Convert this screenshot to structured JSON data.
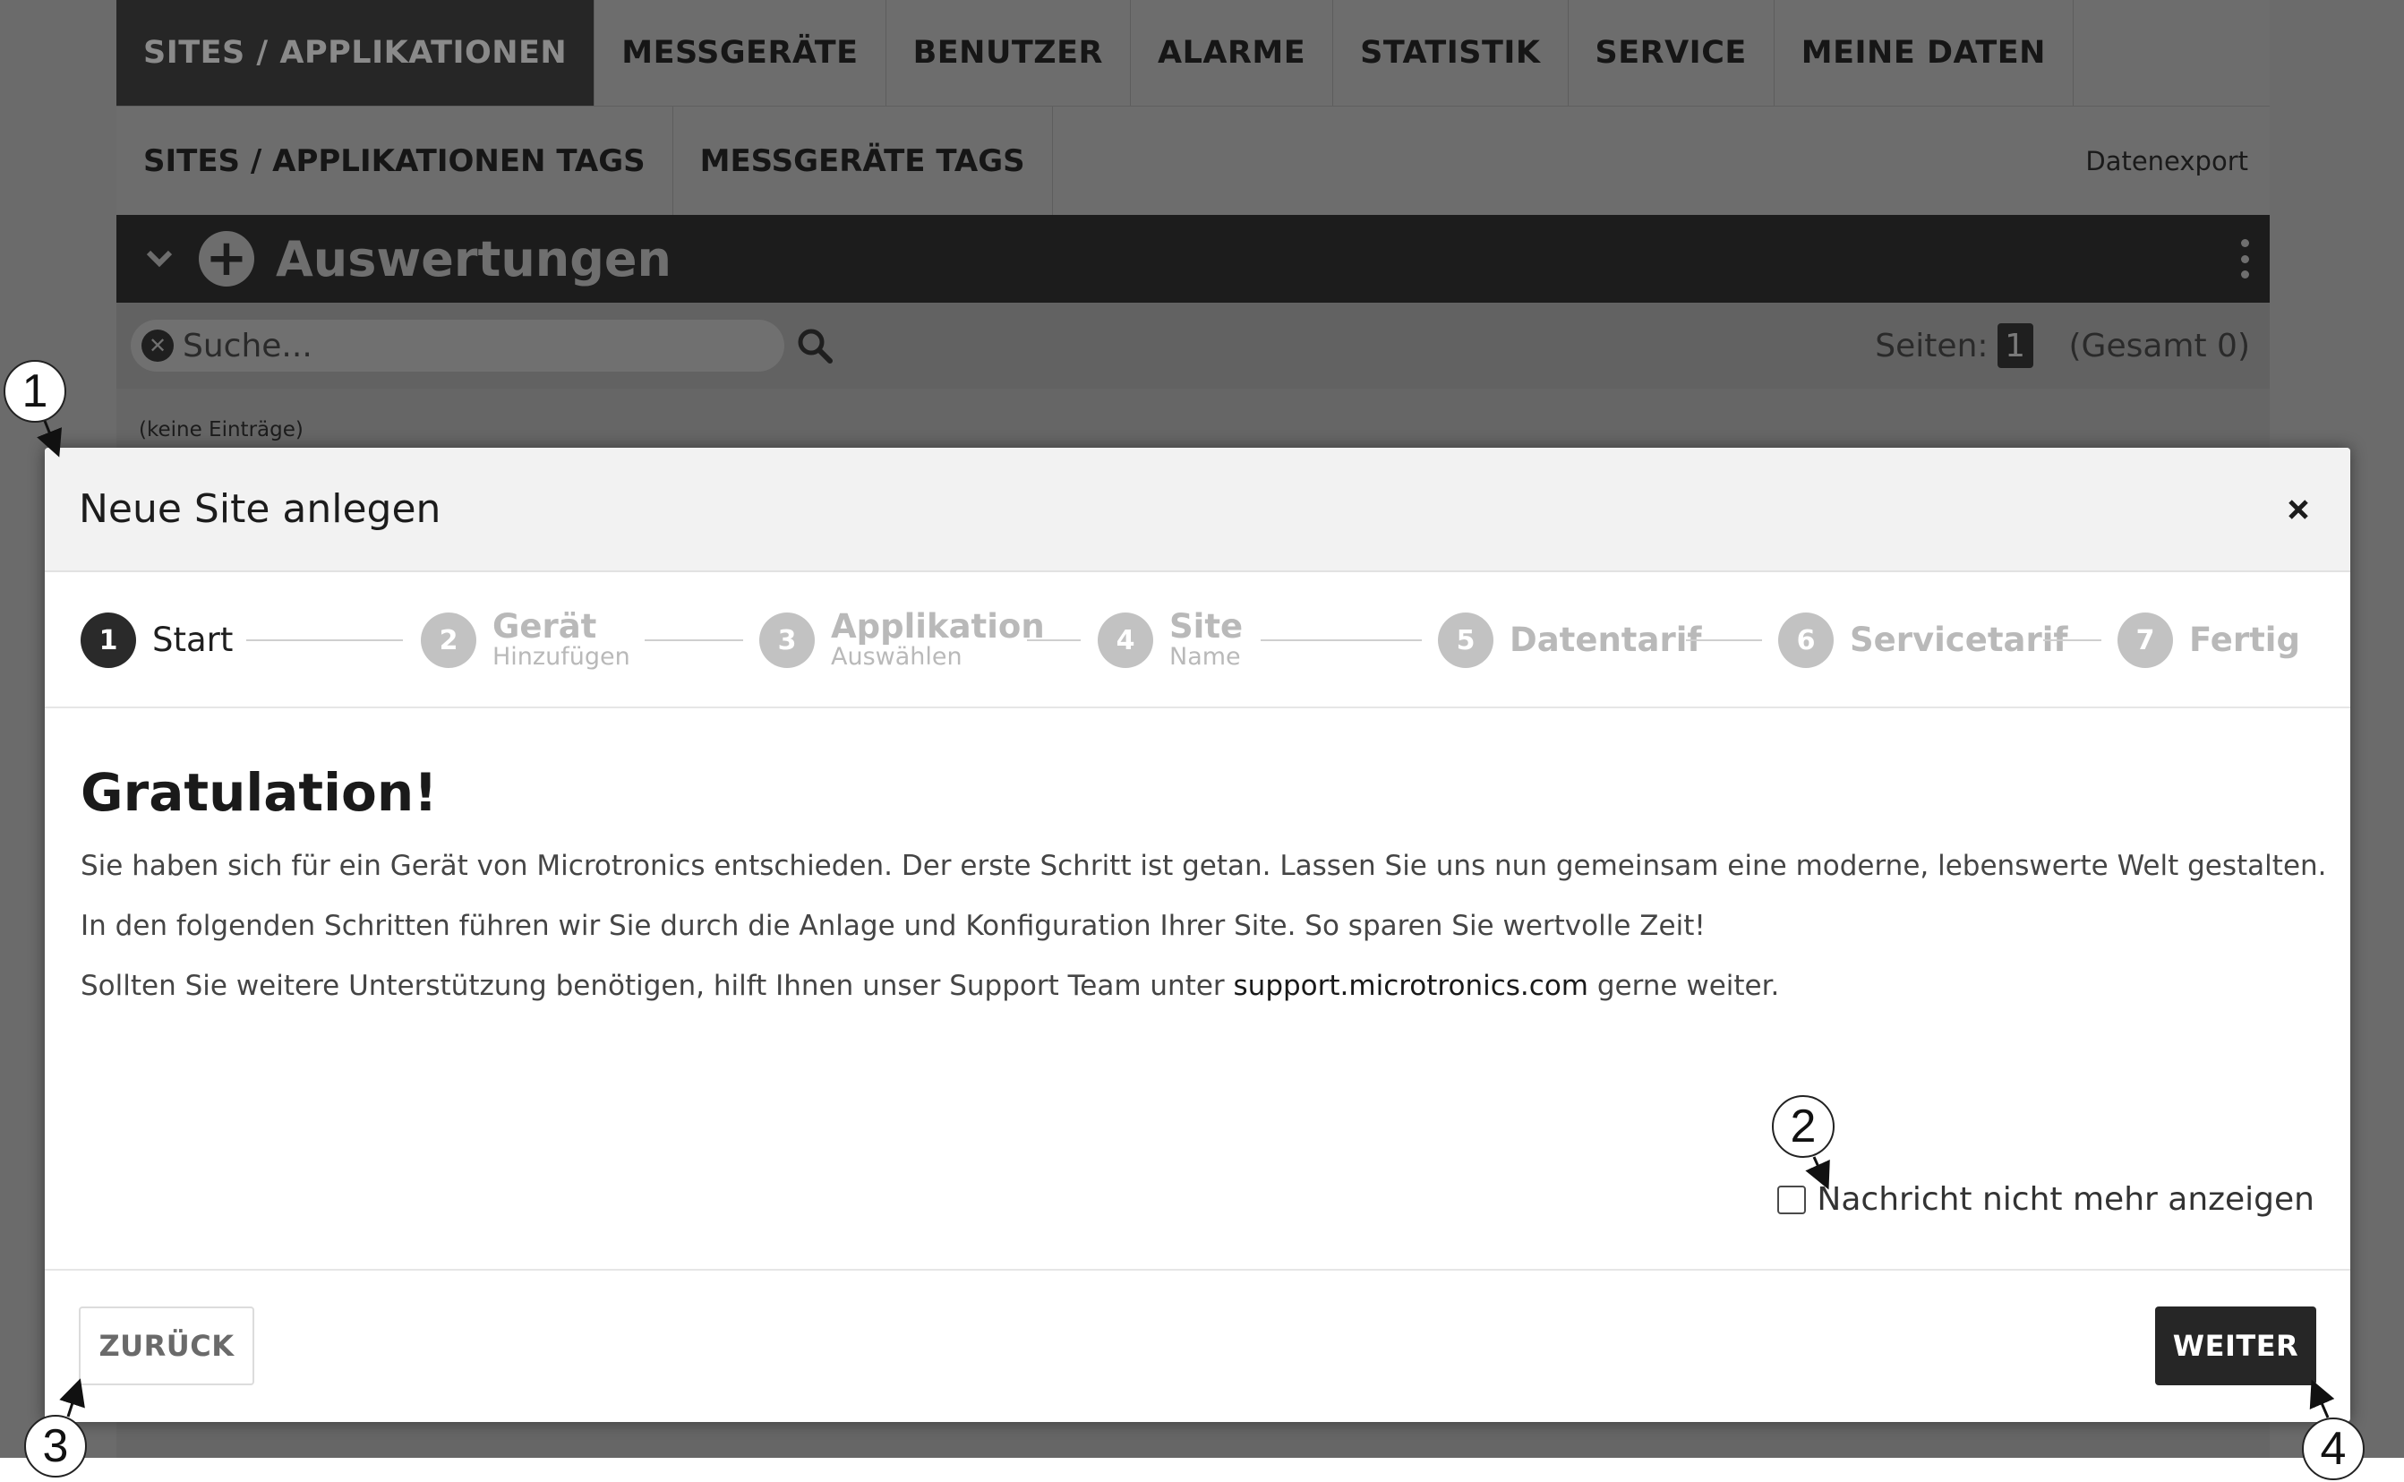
{
  "top_nav": [
    {
      "label": "SITES / APPLIKATIONEN",
      "active": true
    },
    {
      "label": "MESSGERÄTE",
      "active": false
    },
    {
      "label": "BENUTZER",
      "active": false
    },
    {
      "label": "ALARME",
      "active": false
    },
    {
      "label": "STATISTIK",
      "active": false
    },
    {
      "label": "SERVICE",
      "active": false
    },
    {
      "label": "MEINE DATEN",
      "active": false
    }
  ],
  "sub_nav": {
    "items": [
      "SITES / APPLIKATIONEN TAGS",
      "MESSGERÄTE TAGS"
    ],
    "export_label": "Datenexport"
  },
  "section": {
    "title": "Auswertungen"
  },
  "search": {
    "placeholder": "Suche..."
  },
  "pager": {
    "pages_label": "Seiten:",
    "current_page": "1",
    "total_label": "(Gesamt 0)"
  },
  "empty_note": "(keine Einträge)",
  "modal": {
    "title": "Neue Site anlegen",
    "steps": [
      {
        "number": "1",
        "label": "Start",
        "sub": "",
        "active": true
      },
      {
        "number": "2",
        "label": "Gerät",
        "sub": "Hinzufügen",
        "active": false
      },
      {
        "number": "3",
        "label": "Applikation",
        "sub": "Auswählen",
        "active": false
      },
      {
        "number": "4",
        "label": "Site",
        "sub": "Name",
        "active": false
      },
      {
        "number": "5",
        "label": "Datentarif",
        "sub": "",
        "active": false
      },
      {
        "number": "6",
        "label": "Servicetarif",
        "sub": "",
        "active": false
      },
      {
        "number": "7",
        "label": "Fertig",
        "sub": "",
        "active": false
      }
    ],
    "heading": "Gratulation!",
    "paragraph_1": "Sie haben sich für ein Gerät von Microtronics entschieden. Der erste Schritt ist getan. Lassen Sie uns nun gemeinsam eine moderne, lebenswerte Welt gestalten.",
    "paragraph_2": "In den folgenden Schritten führen wir Sie durch die Anlage und Konfiguration Ihrer Site. So sparen Sie wertvolle Zeit!",
    "paragraph_3_before": "Sollten Sie weitere Unterstützung benötigen, hilft Ihnen unser Support Team unter ",
    "paragraph_3_link": "support.microtronics.com",
    "paragraph_3_after": " gerne weiter.",
    "checkbox_label": "Nachricht nicht mehr anzeigen",
    "checkbox_checked": false,
    "back_button": "ZURÜCK",
    "next_button": "WEITER"
  },
  "callouts": [
    "1",
    "2",
    "3",
    "4"
  ],
  "colors": {
    "overlay_bg": "#6b6b6b",
    "active_tab": "#262626",
    "primary_button": "#262626",
    "step_active": "#2a2a2a",
    "step_inactive": "#c2c2c2"
  }
}
